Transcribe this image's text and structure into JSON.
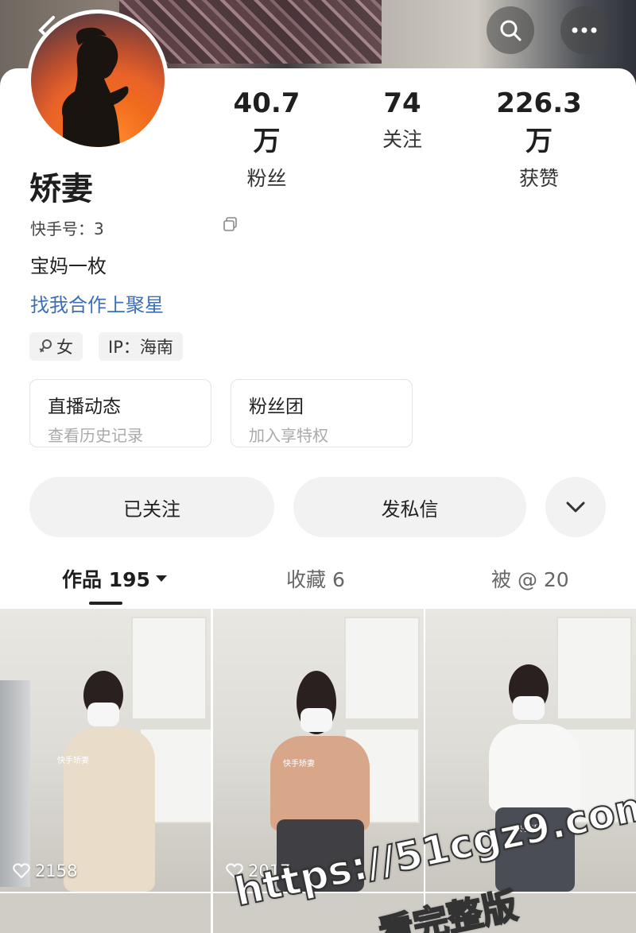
{
  "header": {
    "back_icon": "chevron-left-icon",
    "search_icon": "search-icon",
    "more_icon": "more-dots-icon"
  },
  "profile": {
    "name": "矫妻",
    "kuaishou_id_label": "快手号：3",
    "bio": "宝妈一枚",
    "link_text": "找我合作上聚星",
    "tags": [
      {
        "icon": "female-icon",
        "text": "女"
      },
      {
        "text": "IP：海南"
      }
    ]
  },
  "stats": [
    {
      "value": "40.7万",
      "label": "粉丝"
    },
    {
      "value": "74",
      "label": "关注"
    },
    {
      "value": "226.3万",
      "label": "获赞"
    }
  ],
  "cards": [
    {
      "title": "直播动态",
      "subtitle": "查看历史记录"
    },
    {
      "title": "粉丝团",
      "subtitle": "加入享特权"
    }
  ],
  "actions": {
    "follow_label": "已关注",
    "message_label": "发私信",
    "expand_icon": "chevron-down-icon"
  },
  "tabs": [
    {
      "label": "作品 195",
      "active": true
    },
    {
      "label": "收藏 6",
      "active": false
    },
    {
      "label": "被 @ 20",
      "active": false
    }
  ],
  "videos": [
    {
      "likes": "2158",
      "overlay": "快手矫妻"
    },
    {
      "likes": "2017",
      "overlay": "快手矫妻"
    },
    {
      "likes": "",
      "overlay": "快手矫妻"
    }
  ],
  "watermark": {
    "line1": "https://51cgz9.com",
    "line2": "看完整版"
  }
}
